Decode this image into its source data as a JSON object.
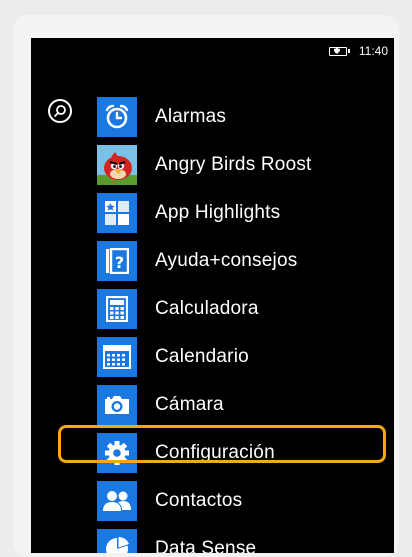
{
  "status_bar": {
    "time": "11:40",
    "battery_icon": "battery-charging-icon"
  },
  "search": {
    "icon": "search-icon"
  },
  "apps": [
    {
      "label": "Alarmas",
      "icon": "alarm-clock-icon"
    },
    {
      "label": "Angry Birds Roost",
      "icon": "angry-birds-icon"
    },
    {
      "label": "App Highlights",
      "icon": "app-highlights-icon"
    },
    {
      "label": "Ayuda+consejos",
      "icon": "help-icon"
    },
    {
      "label": "Calculadora",
      "icon": "calculator-icon"
    },
    {
      "label": "Calendario",
      "icon": "calendar-icon"
    },
    {
      "label": "Cámara",
      "icon": "camera-icon"
    },
    {
      "label": "Configuración",
      "icon": "gear-icon"
    },
    {
      "label": "Contactos",
      "icon": "people-icon"
    },
    {
      "label": "Data Sense",
      "icon": "pie-chart-icon"
    }
  ],
  "highlighted_app": "Configuración",
  "colors": {
    "tile": "#1b78e0",
    "highlight": "#f5a913",
    "background": "#000000"
  }
}
